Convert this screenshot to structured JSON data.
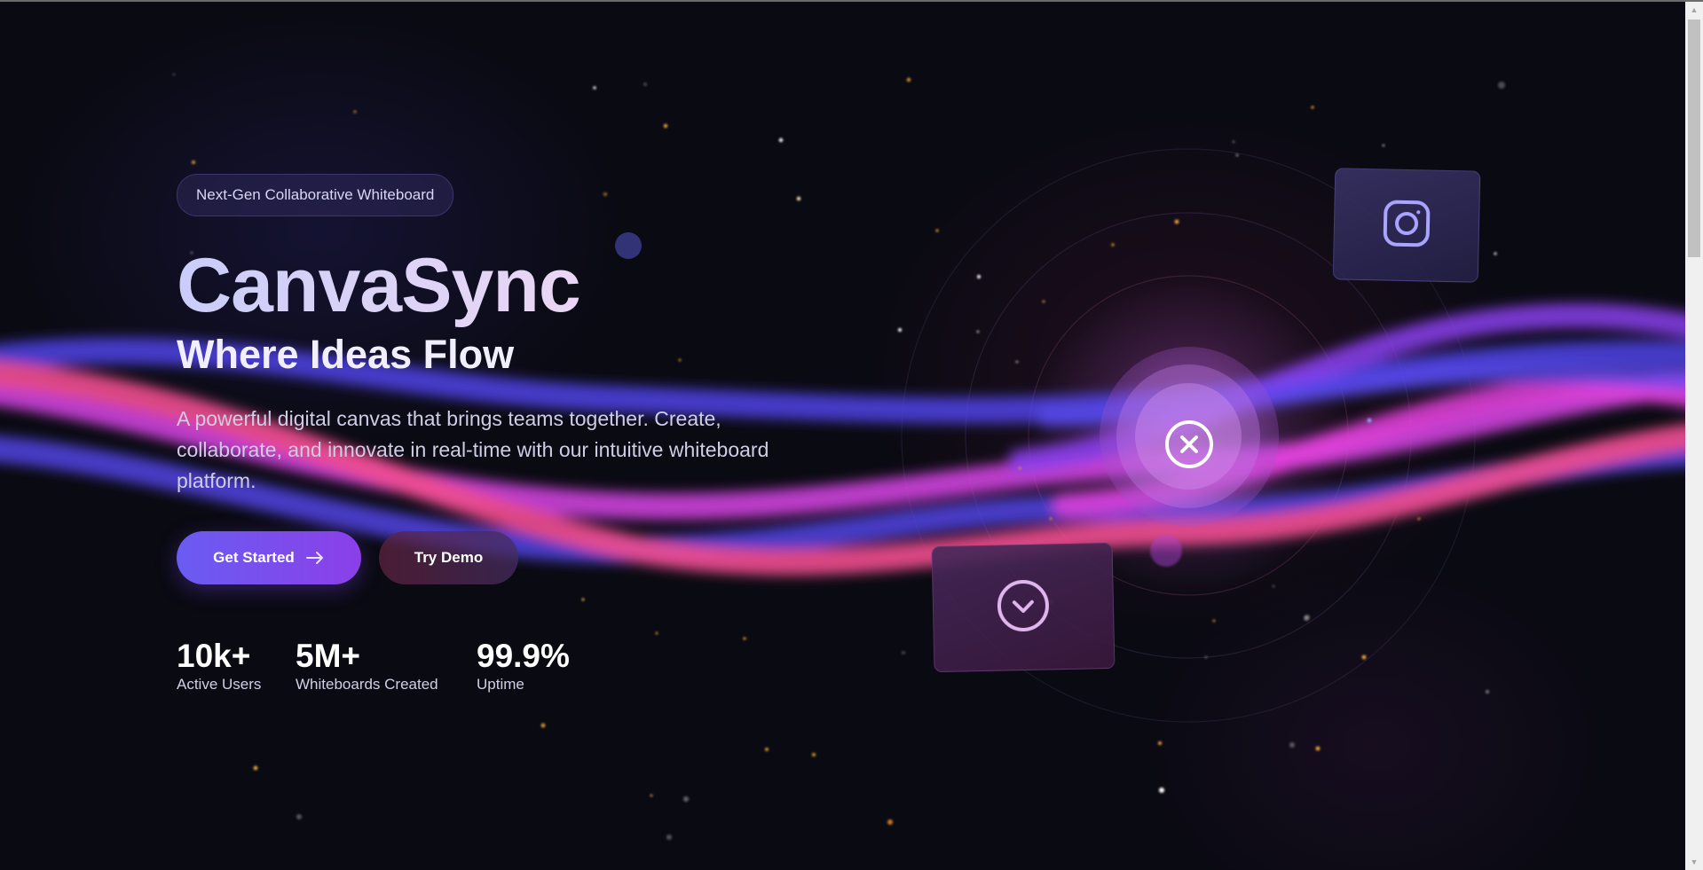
{
  "badge": {
    "text": "Next-Gen Collaborative Whiteboard"
  },
  "hero": {
    "title": "CanvaSync",
    "subtitle": "Where Ideas Flow",
    "description": "A powerful digital canvas that brings teams together. Create, collaborate, and innovate in real-time with our intuitive whiteboard platform."
  },
  "buttons": {
    "primary": {
      "label": "Get Started",
      "icon": "arrow-right-icon"
    },
    "secondary": {
      "label": "Try Demo"
    }
  },
  "stats": [
    {
      "value": "10k+",
      "label": "Active Users"
    },
    {
      "value": "5M+",
      "label": "Whiteboards Created"
    },
    {
      "value": "99.9%",
      "label": "Uptime"
    }
  ],
  "floating": {
    "top_card_icon": "instagram-icon",
    "bottom_card_icon": "chevron-down-circle-icon",
    "orb_icon": "close-circle-icon"
  },
  "colors": {
    "background": "#0a0a12",
    "primary_gradient_start": "#6a5cf2",
    "primary_gradient_end": "#8b3fe8",
    "wave_blue": "#5548f0",
    "wave_pink": "#ef4e8f",
    "wave_magenta": "#d845e8",
    "wave_violet": "#8a3fee"
  }
}
